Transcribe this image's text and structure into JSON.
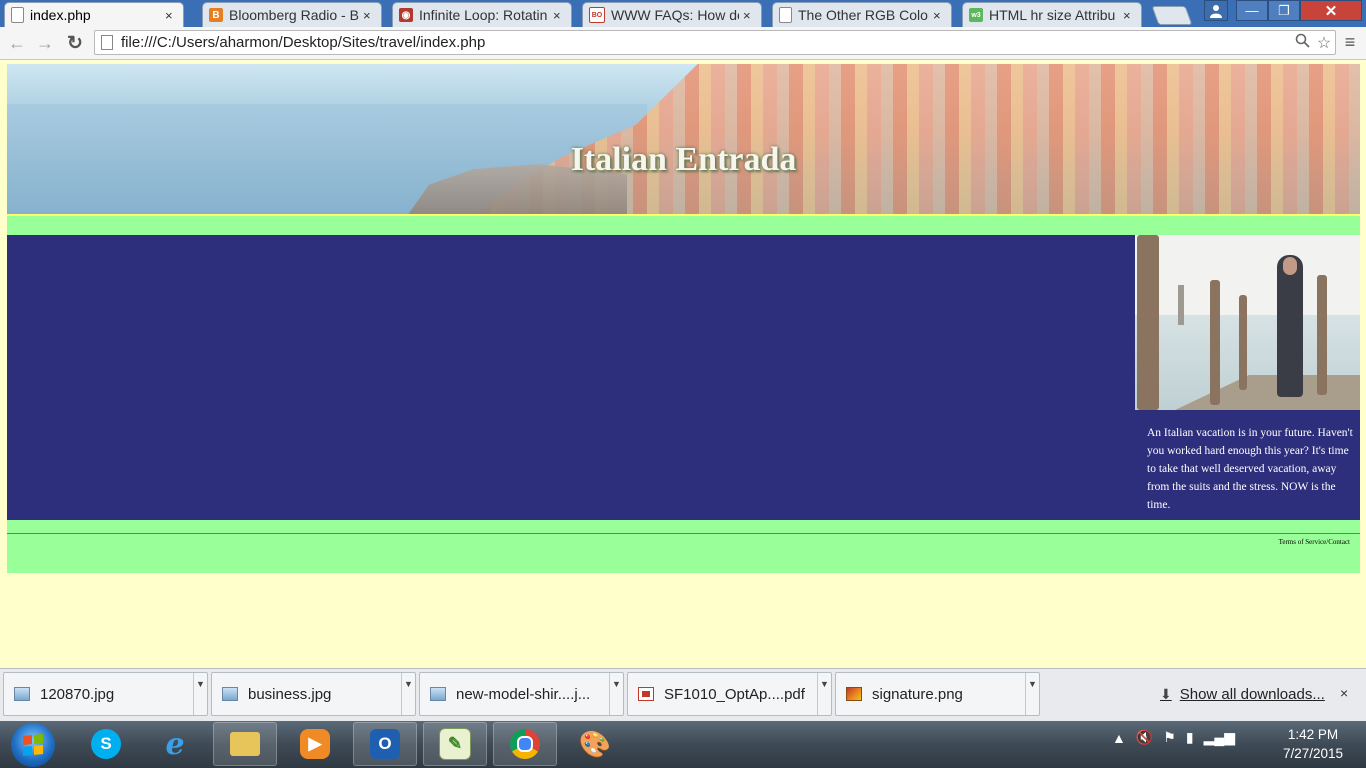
{
  "browser": {
    "tabs": [
      {
        "label": "index.php",
        "icon": "page-icon",
        "active": true
      },
      {
        "label": "Bloomberg Radio - B",
        "icon": "blogger-icon"
      },
      {
        "label": "Infinite Loop: Rotatin",
        "icon": "infinite-loop-icon"
      },
      {
        "label": "WWW FAQs: How de",
        "icon": "boutell-icon"
      },
      {
        "label": "The Other RGB Color",
        "icon": "page-icon"
      },
      {
        "label": "HTML hr size Attribu",
        "icon": "w3schools-icon"
      }
    ],
    "close_tab_glyph": "×",
    "window_controls": {
      "minimize": "—",
      "maximize": "❐",
      "close": "✕"
    },
    "address": "file:///C:/Users/aharmon/Desktop/Sites/travel/index.php",
    "menu_glyph": "≡"
  },
  "page": {
    "title": "Italian Entrada",
    "blurb": "An Italian vacation is in your future. Haven't you worked hard enough this year? It's time to take that well deserved vacation, away from the suits and the stress. NOW is the time.",
    "footer_link": "Terms of Service/Contact",
    "colors": {
      "background": "#ffffcc",
      "nav_strip": "#99ff99",
      "main": "#2e2f7c",
      "accent_line": "#ffff66"
    }
  },
  "downloads": {
    "items": [
      {
        "name": "120870.jpg",
        "icon": "image-file-icon"
      },
      {
        "name": "business.jpg",
        "icon": "image-file-icon"
      },
      {
        "name": "new-model-shir....j...",
        "icon": "image-file-icon"
      },
      {
        "name": "SF1010_OptAp....pdf",
        "icon": "pdf-file-icon"
      },
      {
        "name": "signature.png",
        "icon": "png-file-icon"
      }
    ],
    "show_all": "Show all downloads...",
    "close_glyph": "×"
  },
  "taskbar": {
    "apps": [
      "skype-icon",
      "internet-explorer-icon",
      "file-explorer-icon",
      "media-player-icon",
      "outlook-icon",
      "notepad-plus-icon",
      "chrome-icon",
      "paint-icon"
    ],
    "time": "1:42 PM",
    "date": "7/27/2015"
  }
}
